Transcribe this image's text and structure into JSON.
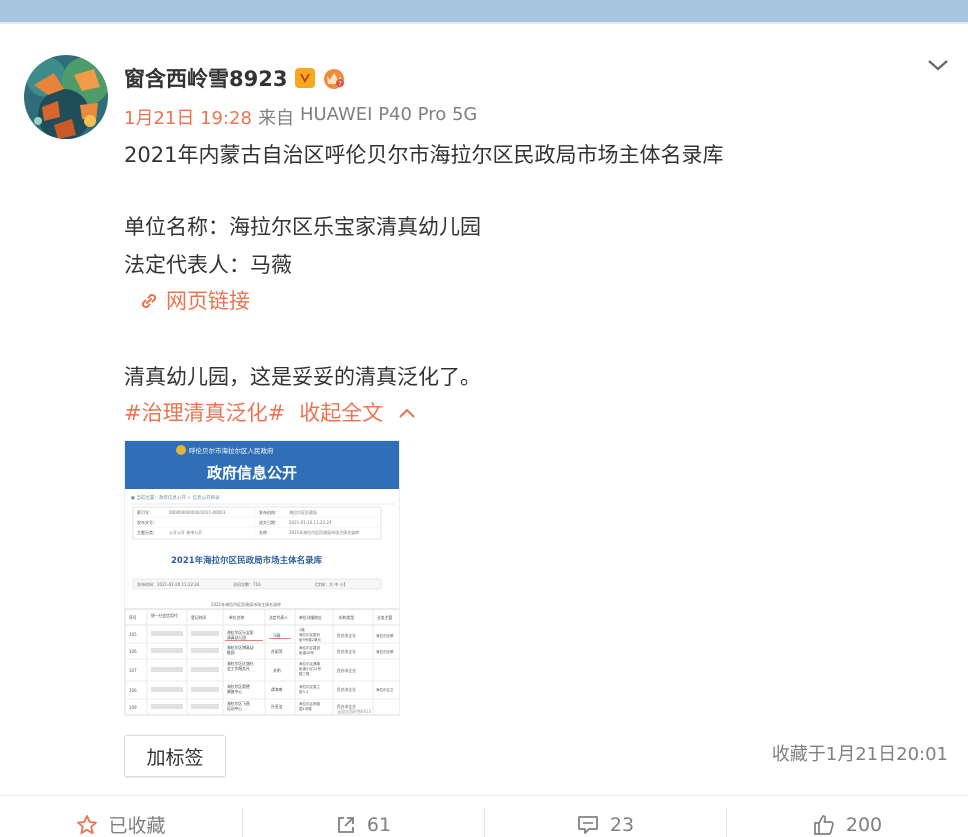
{
  "user": {
    "name": "窗含西岭雪8923"
  },
  "post": {
    "time": "1月21日 19:28",
    "source_prefix": "来自",
    "source": "HUAWEI P40 Pro 5G",
    "text_line1": "2021年内蒙古自治区呼伦贝尔市海拉尔区民政局市场主体名录库",
    "text_line2": "单位名称：海拉尔区乐宝家清真幼儿园",
    "text_line3": "法定代表人：马薇",
    "link_label": "网页链接",
    "text_line4": "清真幼儿园，这是妥妥的清真泛化了。",
    "hashtag": "#治理清真泛化#",
    "collapse_label": "收起全文",
    "image": {
      "banner": "呼伦贝尔市海拉尔区人民政府",
      "heading": "政府信息公开",
      "table_title": "2021年海拉尔区民政局市场主体名录库",
      "publish_time": "发布时间：2021-01-20 11:22:24"
    }
  },
  "footer": {
    "add_tag_label": "加标签",
    "favorite_time": "收藏于1月21日20:01"
  },
  "actions": {
    "favorite_label": "已收藏",
    "repost_count": "61",
    "comment_count": "23",
    "like_count": "200"
  },
  "colors": {
    "accent": "#eb7350",
    "top_bar": "#a7c5dc"
  }
}
